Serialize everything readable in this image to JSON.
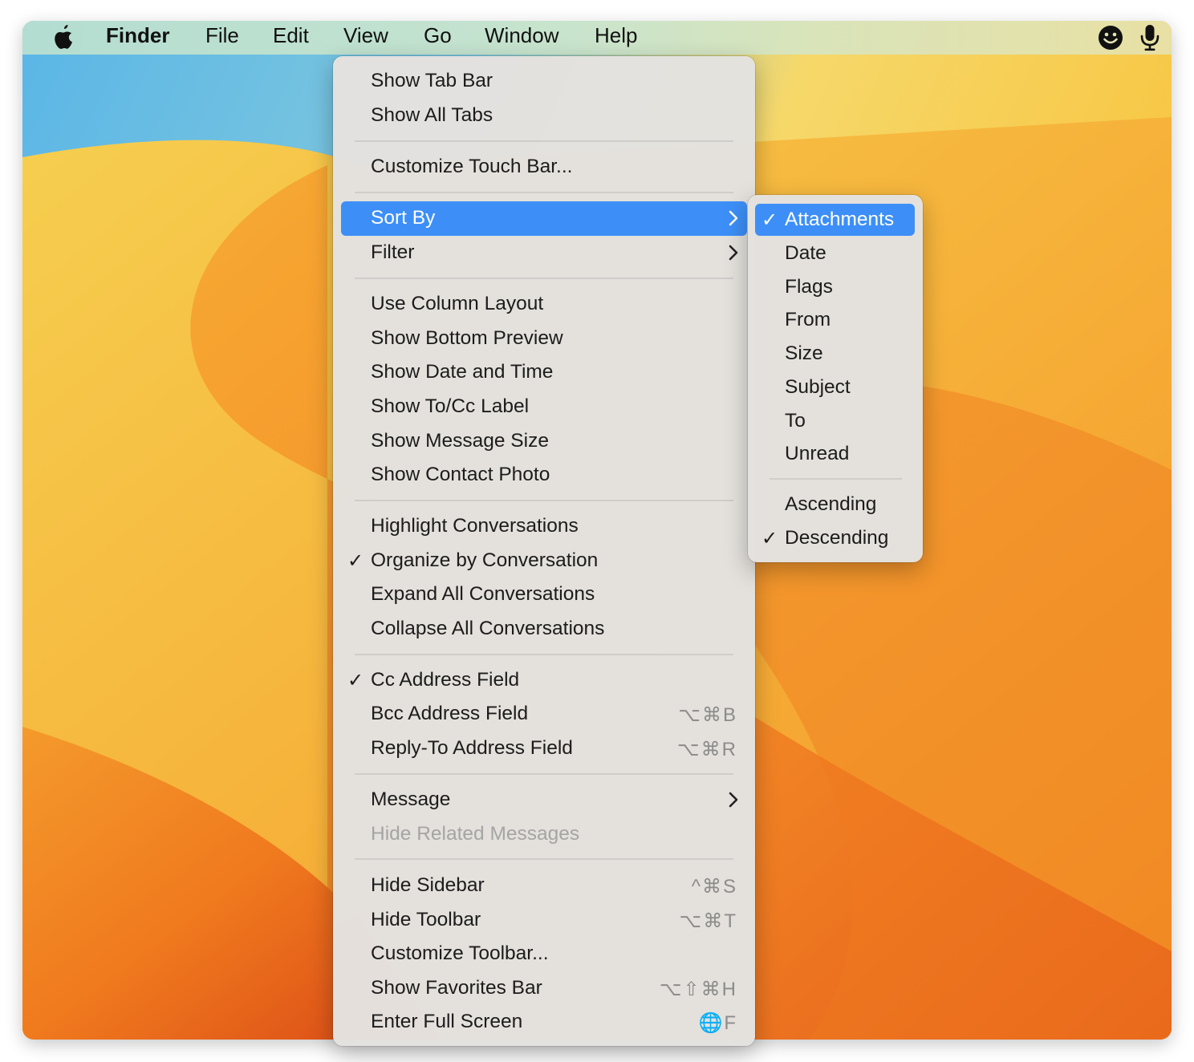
{
  "menubar": {
    "app_name": "Finder",
    "items": [
      "File",
      "Edit",
      "View",
      "Go",
      "Window",
      "Help"
    ]
  },
  "menu": {
    "items": [
      {
        "label": "Show Tab Bar"
      },
      {
        "label": "Show All Tabs"
      },
      {
        "label": "Customize Touch Bar..."
      },
      {
        "label": "Sort By",
        "submenu": true,
        "highlighted": true
      },
      {
        "label": "Filter",
        "submenu": true
      },
      {
        "label": "Use Column Layout"
      },
      {
        "label": "Show Bottom Preview"
      },
      {
        "label": "Show Date and Time"
      },
      {
        "label": "Show To/Cc Label"
      },
      {
        "label": "Show Message Size"
      },
      {
        "label": "Show Contact Photo"
      },
      {
        "label": "Highlight Conversations"
      },
      {
        "label": "Organize by Conversation",
        "checked": true
      },
      {
        "label": "Expand All Conversations"
      },
      {
        "label": "Collapse All Conversations"
      },
      {
        "label": "Cc Address Field",
        "checked": true
      },
      {
        "label": "Bcc Address Field",
        "shortcut": "⌥⌘B"
      },
      {
        "label": "Reply-To Address Field",
        "shortcut": "⌥⌘R"
      },
      {
        "label": "Message",
        "submenu": true
      },
      {
        "label": "Hide Related Messages",
        "disabled": true
      },
      {
        "label": "Hide Sidebar",
        "shortcut": "^⌘S"
      },
      {
        "label": "Hide Toolbar",
        "shortcut": "⌥⌘T"
      },
      {
        "label": "Customize Toolbar..."
      },
      {
        "label": "Show Favorites Bar",
        "shortcut": "⌥⇧⌘H"
      },
      {
        "label": "Enter Full Screen",
        "shortcut": "🌐F"
      }
    ]
  },
  "submenu": {
    "items": [
      {
        "label": "Attachments",
        "checked": true,
        "highlighted": true
      },
      {
        "label": "Date"
      },
      {
        "label": "Flags"
      },
      {
        "label": "From"
      },
      {
        "label": "Size"
      },
      {
        "label": "Subject"
      },
      {
        "label": "To"
      },
      {
        "label": "Unread"
      },
      {
        "label": "Ascending"
      },
      {
        "label": "Descending",
        "checked": true
      }
    ]
  },
  "check_mark": "✓",
  "colors": {
    "highlight": "#3d8ff7",
    "menu_bg": "#e4e2de",
    "disabled_text": "#a5a5a5",
    "shortcut_text": "#8c8c8c"
  }
}
